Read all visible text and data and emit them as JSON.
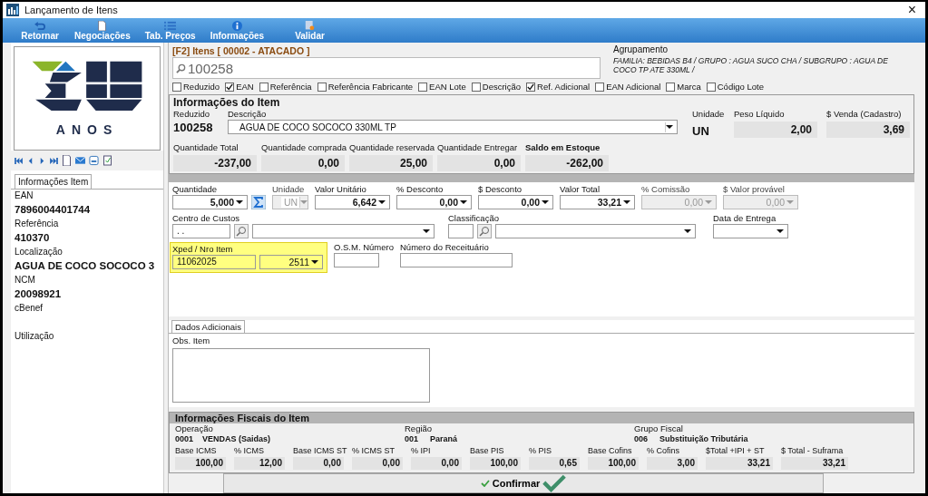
{
  "window": {
    "title": "Lançamento de Itens",
    "close": "×"
  },
  "toolbar": [
    {
      "label": "Retornar",
      "kind": "undo"
    },
    {
      "label": "Negociações",
      "kind": "document"
    },
    {
      "label": "Tab. Preços",
      "kind": "list"
    },
    {
      "label": "Informações",
      "kind": "info"
    },
    {
      "label": "Validar",
      "kind": "validate"
    }
  ],
  "logo": {
    "caption": "ANOS"
  },
  "left_panel": {
    "tab": "Informações Item",
    "fields": [
      {
        "label": "EAN",
        "value": "7896004401744"
      },
      {
        "label": "Referência",
        "value": "410370"
      },
      {
        "label": "Localização",
        "value": "AGUA DE COCO SOCOCO 3"
      },
      {
        "label": "NCM",
        "value": "20098921"
      },
      {
        "label": "cBenef"
      },
      {
        "label": "Utilização"
      }
    ]
  },
  "search": {
    "label": "[F2] Itens [ 00002 - ATACADO ]",
    "value": "100258"
  },
  "grouping": {
    "label": "Agrupamento",
    "text": "FAMILIA: BEBIDAS B4 / GRUPO : AGUA  SUCO  CHA / SUBGRUPO : AGUA DE COCO TP ATE 330ML /"
  },
  "search_options": [
    {
      "label": "Reduzido",
      "checked": false
    },
    {
      "label": "EAN",
      "checked": true
    },
    {
      "label": "Referência",
      "checked": false
    },
    {
      "label": "Referência Fabricante",
      "checked": false
    },
    {
      "label": "EAN Lote",
      "checked": false
    },
    {
      "label": "Descrição",
      "checked": false
    },
    {
      "label": "Ref. Adicional",
      "checked": true
    },
    {
      "label": "EAN Adicional",
      "checked": false
    },
    {
      "label": "Marca",
      "checked": false
    },
    {
      "label": "Código Lote",
      "checked": false
    }
  ],
  "item_info": {
    "title": "Informações do Item",
    "reduzido_label": "Reduzido",
    "reduzido": "100258",
    "descricao_label": "Descrição",
    "descricao": "AGUA DE COCO SOCOCO 330ML TP",
    "unidade_label": "Unidade",
    "unidade": "UN",
    "peso_label": "Peso Líquido",
    "peso": "2,00",
    "venda_label": "$ Venda (Cadastro)",
    "venda": "3,69",
    "quantities": [
      {
        "label": "Quantidade Total",
        "value": "-237,00",
        "emphasis": false
      },
      {
        "label": "Quantidade comprada",
        "value": "0,00",
        "emphasis": false
      },
      {
        "label": "Quantidade reservada",
        "value": "25,00",
        "emphasis": false
      },
      {
        "label": "Quantidade Entregar",
        "value": "0,00",
        "emphasis": false
      },
      {
        "label": "Saldo em Estoque",
        "value": "-262,00",
        "emphasis": true
      }
    ]
  },
  "order_fields": [
    {
      "label": "Quantidade",
      "value": "5,000",
      "disabled": false,
      "kind": "combo-sum"
    },
    {
      "label": "Unidade",
      "value": "UN",
      "disabled": true,
      "kind": "unit"
    },
    {
      "label": "Valor Unitário",
      "value": "6,642",
      "disabled": false,
      "kind": "combo"
    },
    {
      "label": "% Desconto",
      "value": "0,00",
      "disabled": false,
      "kind": "combo"
    },
    {
      "label": "$ Desconto",
      "value": "0,00",
      "disabled": false,
      "kind": "combo"
    },
    {
      "label": "Valor Total",
      "value": "33,21",
      "disabled": false,
      "kind": "combo"
    },
    {
      "label": "% Comissão",
      "value": "0,00",
      "disabled": true,
      "kind": "combo"
    },
    {
      "label": "$ Valor provável",
      "value": "0,00",
      "disabled": true,
      "kind": "combo"
    }
  ],
  "cost_center": {
    "label": "Centro de Custos",
    "code": ". ."
  },
  "classification": {
    "label": "Classificação"
  },
  "delivery_date": {
    "label": "Data de Entrega"
  },
  "xped": {
    "label": "Xped / Nro Item",
    "order": "11062025",
    "item": "2511",
    "highlighted": true
  },
  "osm": {
    "label": "O.S.M. Número"
  },
  "prescription": {
    "label": "Número do Receituário"
  },
  "additional": {
    "tab": "Dados Adicionais",
    "obs_label": "Obs. Item"
  },
  "fiscal": {
    "title": "Informações Fiscais do Item",
    "groups": [
      {
        "label": "Operação",
        "code": "0001",
        "name": "VENDAS (Saidas)"
      },
      {
        "label": "Região",
        "code": "001",
        "name": "Paraná"
      },
      {
        "label": "Grupo Fiscal",
        "code": "006",
        "name": "Substituição Tributária"
      }
    ],
    "taxes": [
      {
        "label": "Base ICMS",
        "value": "100,00"
      },
      {
        "label": "% ICMS",
        "value": "12,00"
      },
      {
        "label": "Base ICMS ST",
        "value": "0,00"
      },
      {
        "label": "% ICMS ST",
        "value": "0,00"
      },
      {
        "label": "% IPI",
        "value": "0,00"
      },
      {
        "label": "Base PIS",
        "value": "100,00"
      },
      {
        "label": "% PIS",
        "value": "0,65"
      },
      {
        "label": "Base Cofins",
        "value": "100,00"
      },
      {
        "label": "% Cofins",
        "value": "3,00"
      },
      {
        "label": "$Total +IPI + ST",
        "value": "33,21"
      },
      {
        "label": "$ Total - Suframa",
        "value": "33,21"
      }
    ]
  },
  "confirm": {
    "label": "Confirmar"
  }
}
